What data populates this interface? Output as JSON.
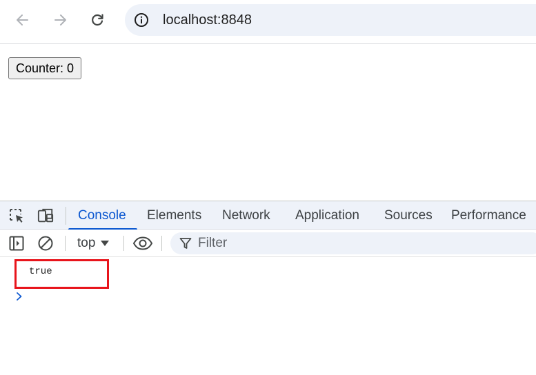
{
  "browser": {
    "url": "localhost:8848",
    "icons": {
      "back": "arrow-left-icon",
      "forward": "arrow-right-icon",
      "reload": "reload-icon",
      "site_info": "info-circle-icon"
    }
  },
  "page": {
    "counter_button_label": "Counter: 0"
  },
  "devtools": {
    "tabs": [
      {
        "label": "Console",
        "active": true
      },
      {
        "label": "Elements",
        "active": false
      },
      {
        "label": "Network",
        "active": false
      },
      {
        "label": "Application",
        "active": false
      },
      {
        "label": "Sources",
        "active": false
      },
      {
        "label": "Performance",
        "active": false
      }
    ],
    "console_toolbar": {
      "context": "top",
      "filter_placeholder": "Filter"
    },
    "console_output": [
      {
        "text": "true"
      }
    ],
    "colors": {
      "accent": "#0b57d0",
      "highlight": "#e8141b"
    }
  }
}
